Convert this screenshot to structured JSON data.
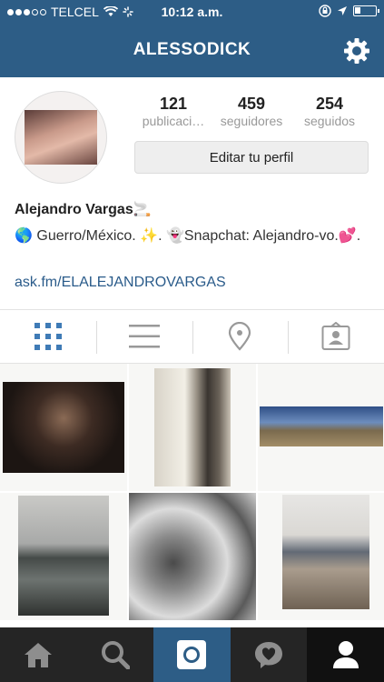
{
  "status_bar": {
    "carrier": "TELCEL",
    "time": "10:12 a.m.",
    "battery_level": 0.25
  },
  "header": {
    "username": "ALESSODICK",
    "settings_icon": "gear-icon"
  },
  "profile": {
    "stats": [
      {
        "count": "121",
        "label": "publicaci…"
      },
      {
        "count": "459",
        "label": "seguidores"
      },
      {
        "count": "254",
        "label": "seguidos"
      }
    ],
    "edit_button": "Editar tu perfil",
    "full_name": "Alejandro Vargas🚬",
    "bio": "🌎 Guerro/México. ✨. 👻Snapchat: Alejandro-vo.💕.",
    "website": "ask.fm/ELALEJANDROVARGAS"
  },
  "view_tabs": [
    {
      "icon": "grid-icon",
      "active": true
    },
    {
      "icon": "list-icon",
      "active": false
    },
    {
      "icon": "location-pin-icon",
      "active": false
    },
    {
      "icon": "tagged-photos-icon",
      "active": false
    }
  ],
  "bottom_nav": [
    {
      "icon": "home-icon"
    },
    {
      "icon": "search-icon"
    },
    {
      "icon": "camera-icon"
    },
    {
      "icon": "activity-icon"
    },
    {
      "icon": "profile-icon",
      "active": true
    }
  ],
  "colors": {
    "header": "#2d5d86",
    "accent": "#3f7bb6",
    "tab_bar": "#252525",
    "link": "#2a5b8a"
  }
}
